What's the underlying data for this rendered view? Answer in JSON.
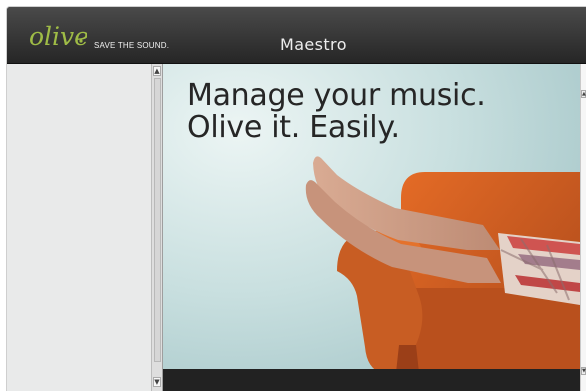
{
  "app": {
    "window_title": "Maestro"
  },
  "brand": {
    "name": "olive",
    "tagline": "SAVE THE SOUND.",
    "logo_color": "#9fbc46"
  },
  "hero": {
    "headline_line1": "Manage your music.",
    "headline_line2": "Olive it. Easily.",
    "background_color": "#c8dfdf"
  },
  "scrollbars": {
    "up_arrow": "▲",
    "down_arrow": "▼"
  },
  "colors": {
    "header_dark": "#262626",
    "sidebar": "#e9eaea",
    "sofa_orange": "#c8581e"
  }
}
